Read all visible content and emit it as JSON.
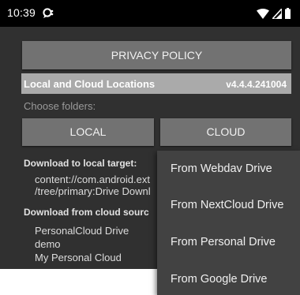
{
  "status_bar": {
    "time": "10:39",
    "icons": [
      "notification-bubble-icon",
      "wifi-icon",
      "signal-icon",
      "battery-icon"
    ]
  },
  "privacy_button": {
    "label": "PRIVACY POLICY"
  },
  "header": {
    "title": "Local and Cloud Locations",
    "version": "v4.4.4.241004"
  },
  "choose_folders": {
    "label": "Choose folders:"
  },
  "buttons": {
    "local_label": "LOCAL",
    "cloud_label": "CLOUD"
  },
  "download_local": {
    "label": "Download to local target:",
    "path_line1": "content://com.android.ext",
    "path_line2": "/tree/primary:Drive Downl"
  },
  "download_cloud": {
    "label": "Download from cloud sourc",
    "items": [
      "PersonalCloud Drive",
      "demo",
      "My Personal Cloud"
    ]
  },
  "cloud_menu": {
    "items": [
      "From Webdav Drive",
      "From NextCloud Drive",
      "From Personal Drive",
      "From Google Drive"
    ]
  },
  "colors": {
    "app_background": "#303030",
    "button": "#727272",
    "header_band": "#aaaaaa",
    "menu": "#424242",
    "status_bar": "#000000"
  }
}
